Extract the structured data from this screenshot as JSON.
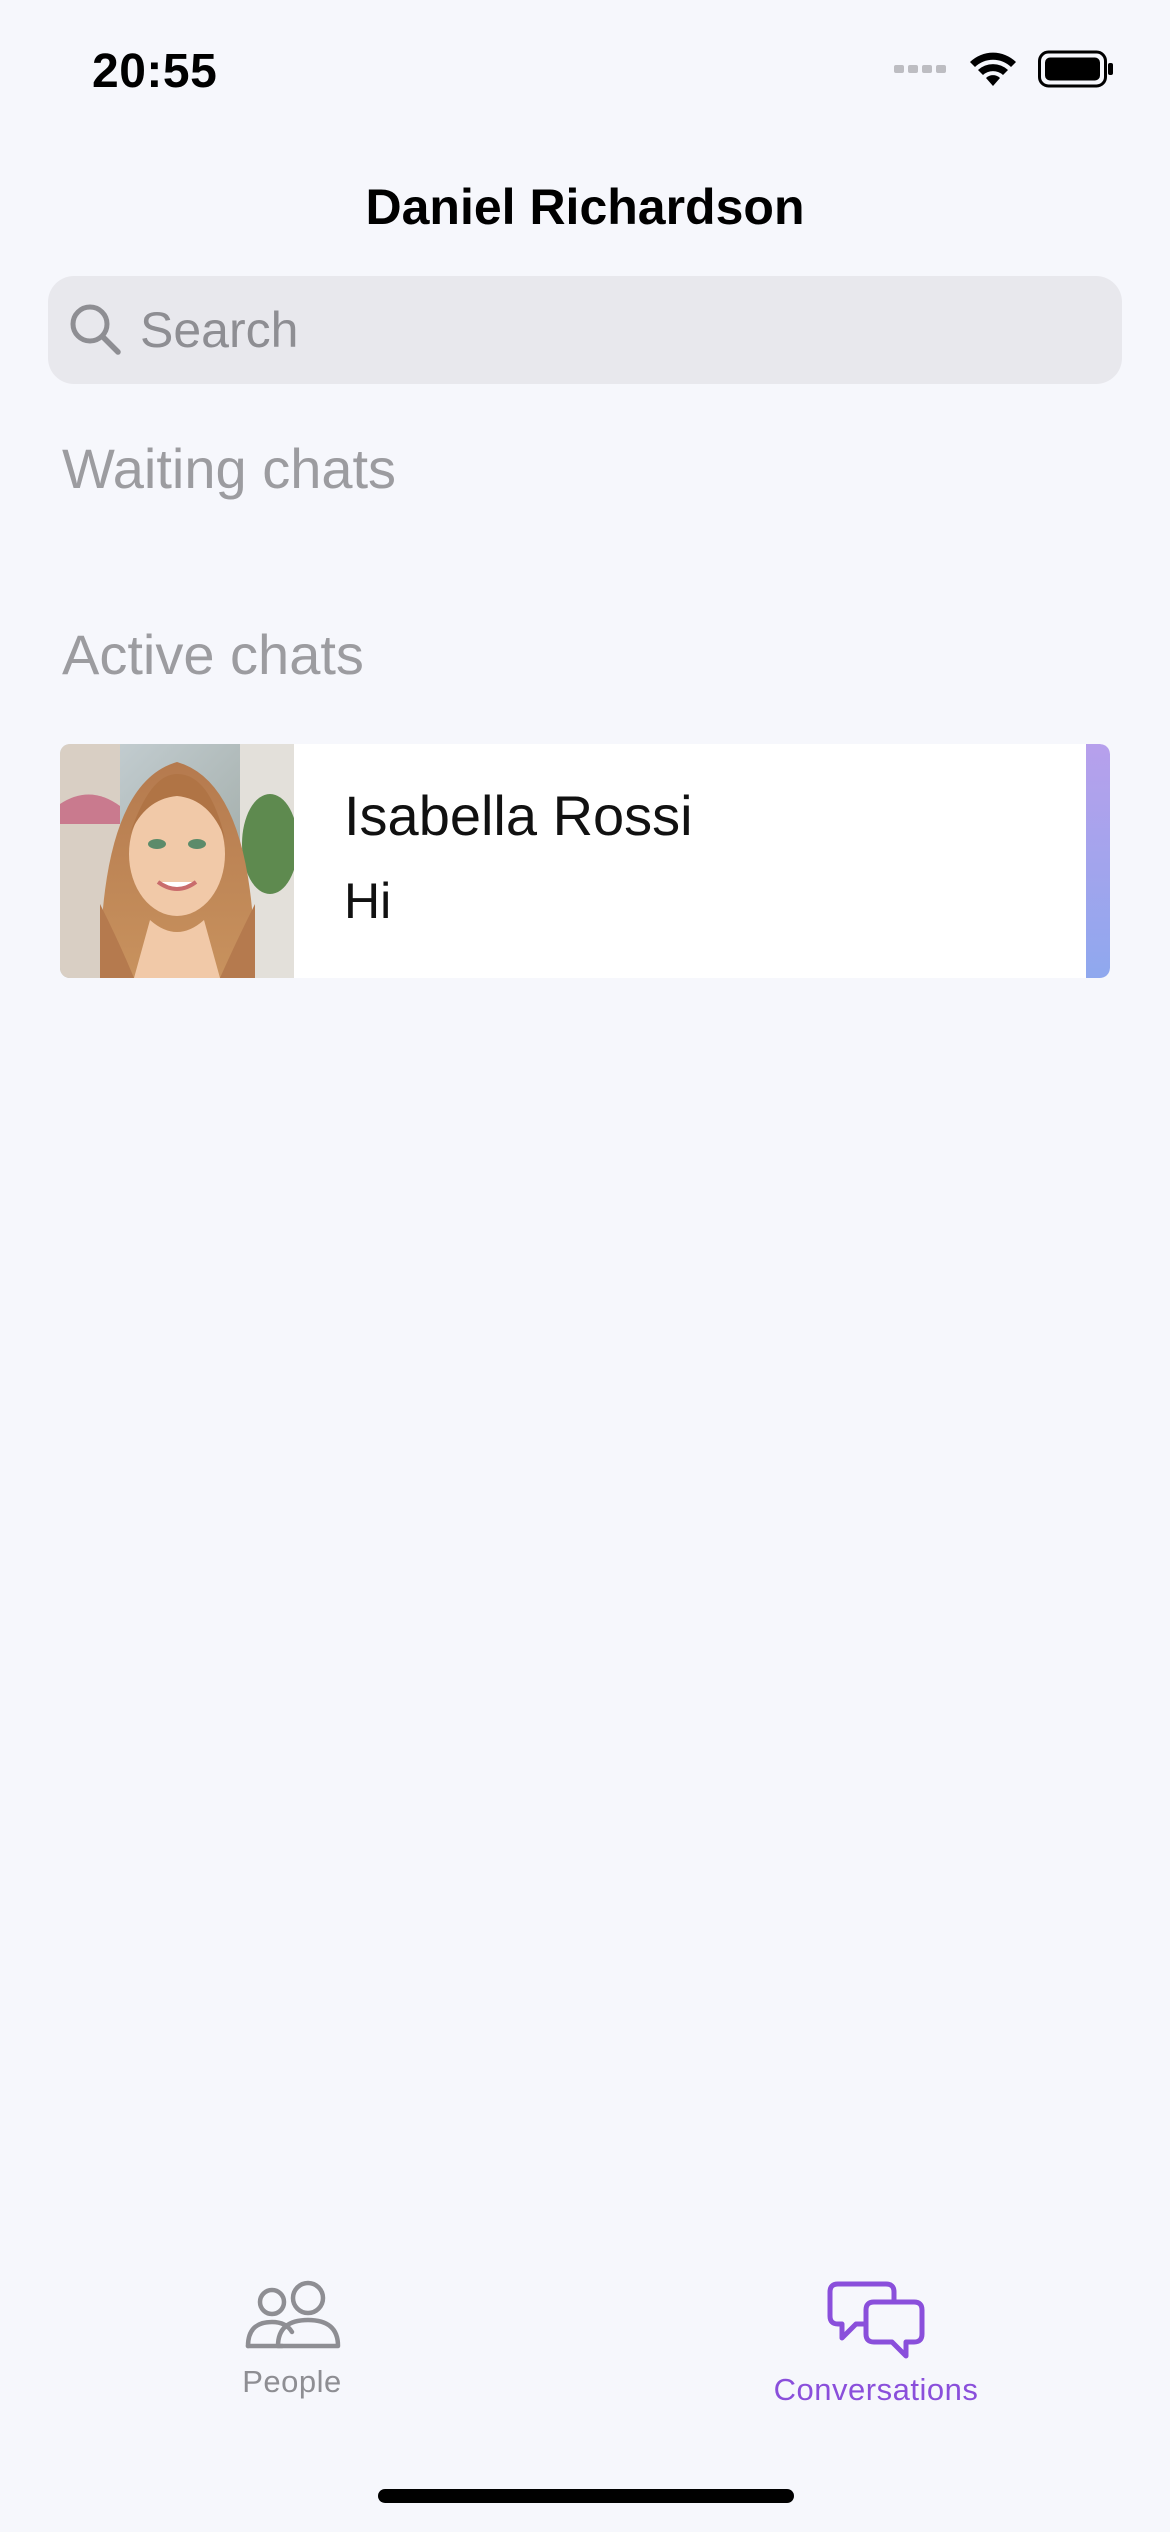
{
  "status_bar": {
    "time": "20:55",
    "icons": [
      "signal-icon",
      "wifi-icon",
      "battery-icon"
    ]
  },
  "header": {
    "title": "Daniel Richardson"
  },
  "search": {
    "placeholder": "Search",
    "value": ""
  },
  "sections": {
    "waiting_title": "Waiting chats",
    "active_title": "Active chats"
  },
  "active_chats": [
    {
      "name": "Isabella Rossi",
      "last_message": "Hi",
      "avatar": "profile-photo"
    }
  ],
  "tab_bar": {
    "people_label": "People",
    "conversations_label": "Conversations",
    "active_tab": "Conversations",
    "active_color": "#8A4FDB",
    "inactive_color": "#8E8E93"
  },
  "colors": {
    "background": "#F6F7FC",
    "accent_gradient_start": "#B7A0EC",
    "accent_gradient_end": "#8FA8EE"
  }
}
